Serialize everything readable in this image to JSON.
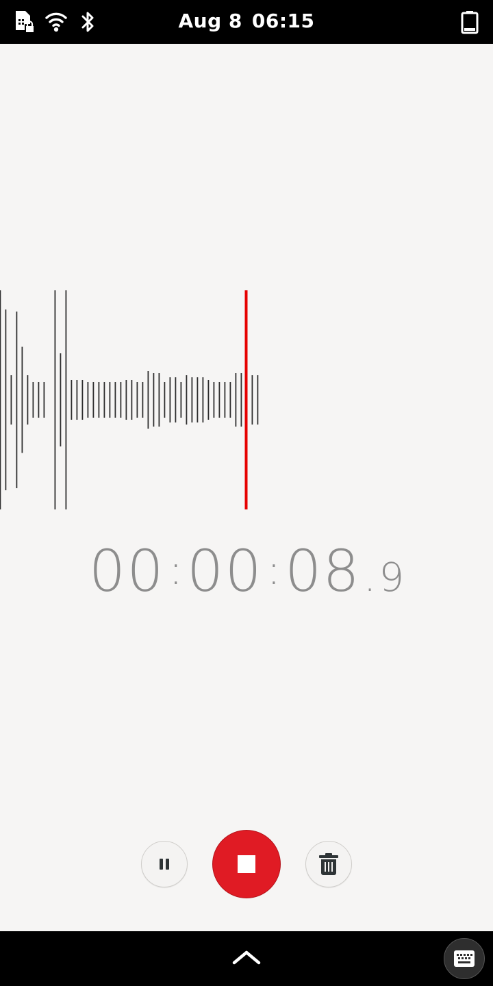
{
  "status_bar": {
    "date": "Aug 8",
    "time": "06:15",
    "icons": [
      "sim-locked-icon",
      "wifi-icon",
      "bluetooth-icon",
      "battery-icon"
    ]
  },
  "recorder": {
    "timer": {
      "hours": "00",
      "minutes": "00",
      "seconds": "08",
      "tenths": "9",
      "separator": ":",
      "decimal": "."
    },
    "colors": {
      "accent": "#e01b24",
      "waveform": "#2e2e2e",
      "playhead": "#e60000",
      "timer_text": "#8d8d8d",
      "background": "#f6f5f4"
    },
    "controls": {
      "pause": "pause-icon",
      "stop": "stop-icon",
      "delete": "trash-icon"
    }
  },
  "nav_bar": {
    "home": "chevron-up-icon",
    "keyboard": "keyboard-icon"
  }
}
